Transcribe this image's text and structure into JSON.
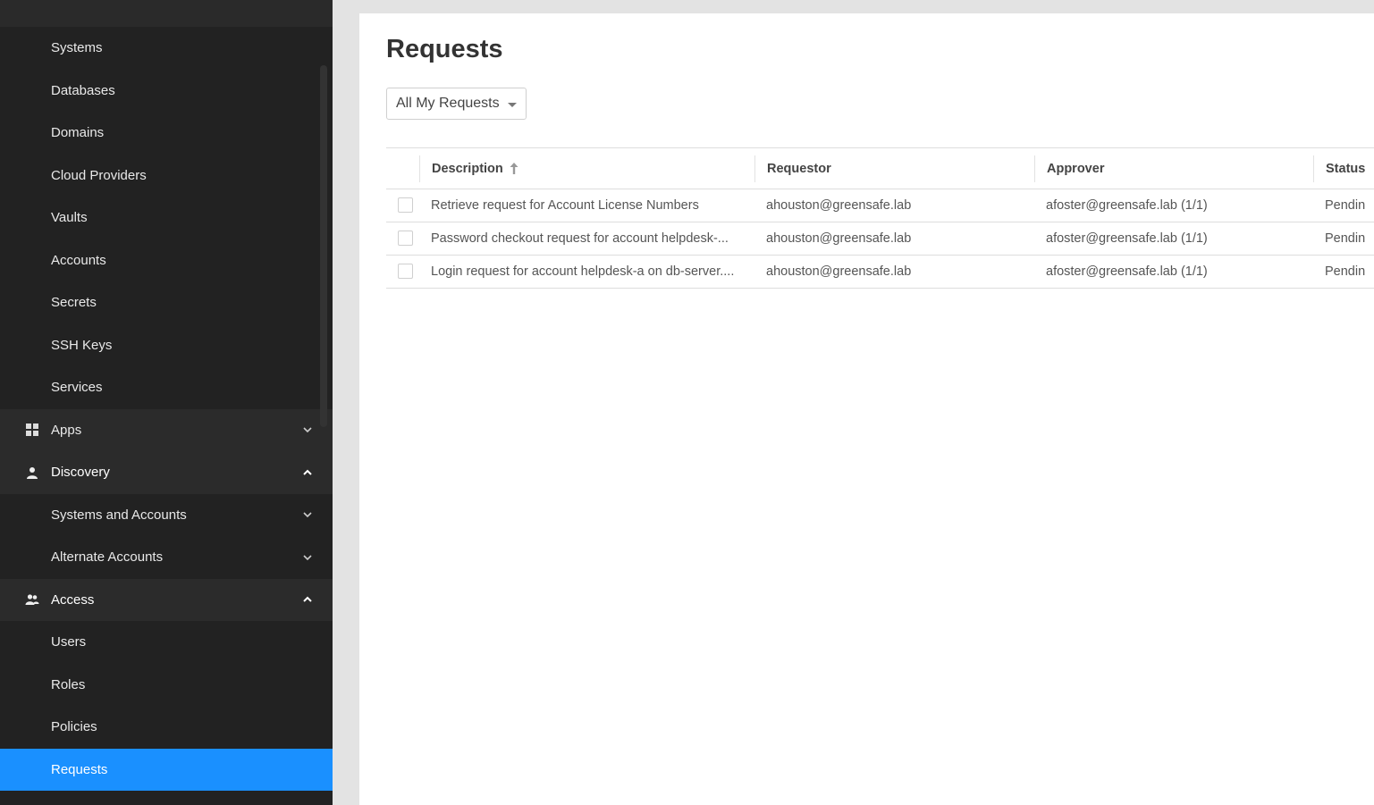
{
  "sidebar": {
    "sub_items_top": [
      {
        "label": "Systems"
      },
      {
        "label": "Databases"
      },
      {
        "label": "Domains"
      },
      {
        "label": "Cloud Providers"
      },
      {
        "label": "Vaults"
      },
      {
        "label": "Accounts"
      },
      {
        "label": "Secrets"
      },
      {
        "label": "SSH Keys"
      },
      {
        "label": "Services"
      }
    ],
    "apps": {
      "label": "Apps",
      "icon": "apps-grid-icon"
    },
    "discovery": {
      "label": "Discovery",
      "icon": "discovery-icon",
      "items": [
        {
          "label": "Systems and Accounts"
        },
        {
          "label": "Alternate Accounts"
        }
      ]
    },
    "access": {
      "label": "Access",
      "icon": "users-icon",
      "items": [
        {
          "label": "Users"
        },
        {
          "label": "Roles"
        },
        {
          "label": "Policies"
        },
        {
          "label": "Requests"
        }
      ]
    },
    "active_color": "#1a90ff"
  },
  "main": {
    "title": "Requests",
    "filter": {
      "selected": "All My Requests"
    },
    "table": {
      "columns": [
        {
          "label": "Description",
          "sort": "ascending"
        },
        {
          "label": "Requestor"
        },
        {
          "label": "Approver"
        },
        {
          "label": "Status"
        }
      ],
      "rows": [
        {
          "description": "Retrieve request for Account License Numbers",
          "requestor": "ahouston@greensafe.lab",
          "approver": "afoster@greensafe.lab (1/1)",
          "status": "Pendin"
        },
        {
          "description": "Password checkout request for account helpdesk-...",
          "requestor": "ahouston@greensafe.lab",
          "approver": "afoster@greensafe.lab (1/1)",
          "status": "Pendin"
        },
        {
          "description": "Login request for account helpdesk-a on db-server....",
          "requestor": "ahouston@greensafe.lab",
          "approver": "afoster@greensafe.lab (1/1)",
          "status": "Pendin"
        }
      ]
    }
  }
}
